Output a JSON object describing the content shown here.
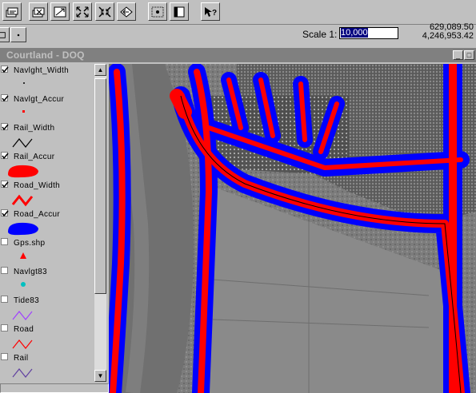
{
  "toolbar": {
    "buttons": [
      {
        "name": "add-theme-icon"
      },
      {
        "name": "theme-properties-icon"
      },
      {
        "name": "edit-legend-icon"
      },
      {
        "name": "zoom-full-extent-icon"
      },
      {
        "name": "zoom-active-themes-icon"
      },
      {
        "name": "zoom-previous-icon"
      },
      {
        "name": "select-features-icon"
      },
      {
        "name": "open-table-icon"
      },
      {
        "name": "help-icon"
      }
    ]
  },
  "toolbar2": {
    "scale_label": "Scale 1:",
    "scale_value": "10,000",
    "coord_x": "629,089.50",
    "coord_y": "4,246,953.42"
  },
  "window": {
    "title": "Courtland - DOQ",
    "minimize": "_",
    "maximize": "□"
  },
  "layers": [
    {
      "label": "Navlght_Width",
      "checked": true,
      "symbol": "dot-small",
      "color": "#000000"
    },
    {
      "label": "Navlgt_Accur",
      "checked": true,
      "symbol": "dot-red",
      "color": "#ff0000"
    },
    {
      "label": "Rail_Width",
      "checked": true,
      "symbol": "line",
      "color": "#000000"
    },
    {
      "label": "Rail_Accur",
      "checked": true,
      "symbol": "blob",
      "color": "#ff0000"
    },
    {
      "label": "Road_Width",
      "checked": true,
      "symbol": "line-thick",
      "color": "#ff0000"
    },
    {
      "label": "Road_Accur",
      "checked": true,
      "symbol": "blob",
      "color": "#0000ff"
    },
    {
      "label": "Gps.shp",
      "checked": false,
      "symbol": "triangle",
      "color": "#ff0000"
    },
    {
      "label": "Navlgt83",
      "checked": false,
      "symbol": "dot",
      "color": "#00c0c0"
    },
    {
      "label": "Tide83",
      "checked": false,
      "symbol": "line",
      "color": "#a040ff"
    },
    {
      "label": "Road",
      "checked": false,
      "symbol": "line",
      "color": "#ff0000"
    },
    {
      "label": "Rail",
      "checked": false,
      "symbol": "line",
      "color": "#6040a0"
    }
  ]
}
